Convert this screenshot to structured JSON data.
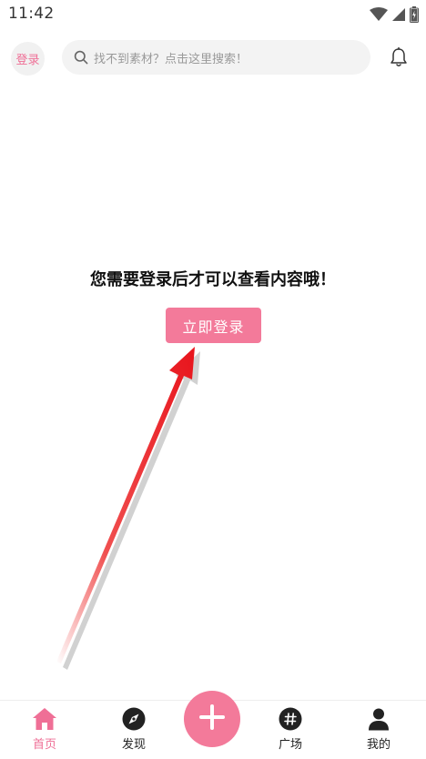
{
  "status_bar": {
    "time": "11:42",
    "icons": [
      "wifi-icon",
      "cell-signal-icon",
      "battery-icon"
    ]
  },
  "header": {
    "login_label": "登录",
    "search_placeholder": "找不到素材？点击这里搜索！",
    "bell_icon": "bell-icon"
  },
  "main": {
    "prompt": "您需要登录后才可以查看内容哦！",
    "login_button": "立即登录"
  },
  "bottom_nav": {
    "items": [
      {
        "label": "首页",
        "icon": "home-icon",
        "active": true
      },
      {
        "label": "发现",
        "icon": "compass-icon",
        "active": false
      },
      {
        "label": "广场",
        "icon": "hashtag-icon",
        "active": false
      },
      {
        "label": "我的",
        "icon": "person-icon",
        "active": false
      }
    ],
    "fab_icon": "plus-icon"
  },
  "colors": {
    "accent": "#f37a9a",
    "accent_text": "#ef6f96",
    "arrow": "#e8141c"
  }
}
